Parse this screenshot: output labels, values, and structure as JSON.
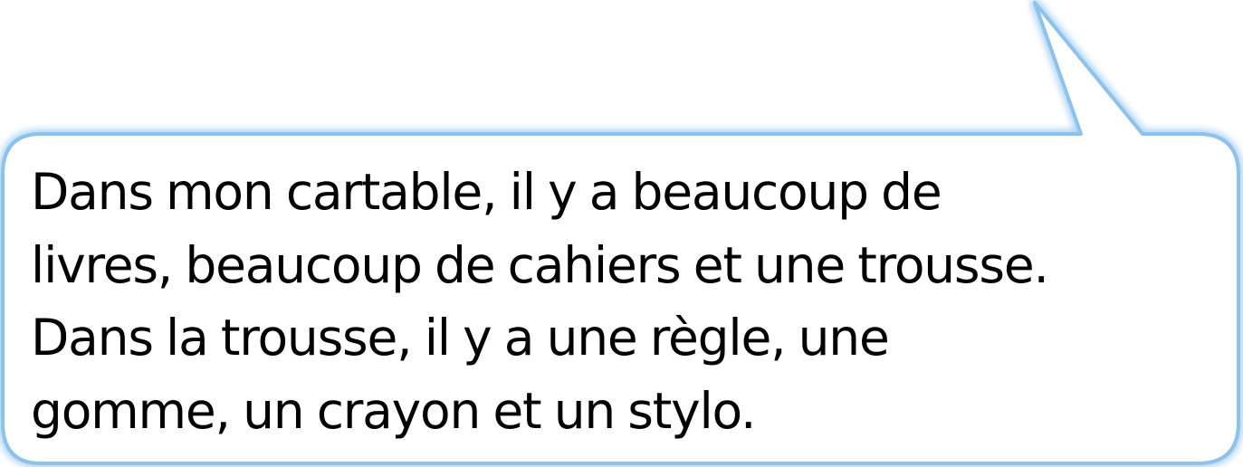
{
  "speech_bubble": {
    "lines": [
      "Dans mon cartable, il y a beaucoup de",
      "livres, beaucoup de cahiers et une trousse.",
      "Dans la trousse, il y a une règle, une",
      "gomme, un crayon et un stylo."
    ],
    "border_color": "#8cc3ee",
    "fill_color": "#ffffff",
    "text_color": "#000000"
  }
}
